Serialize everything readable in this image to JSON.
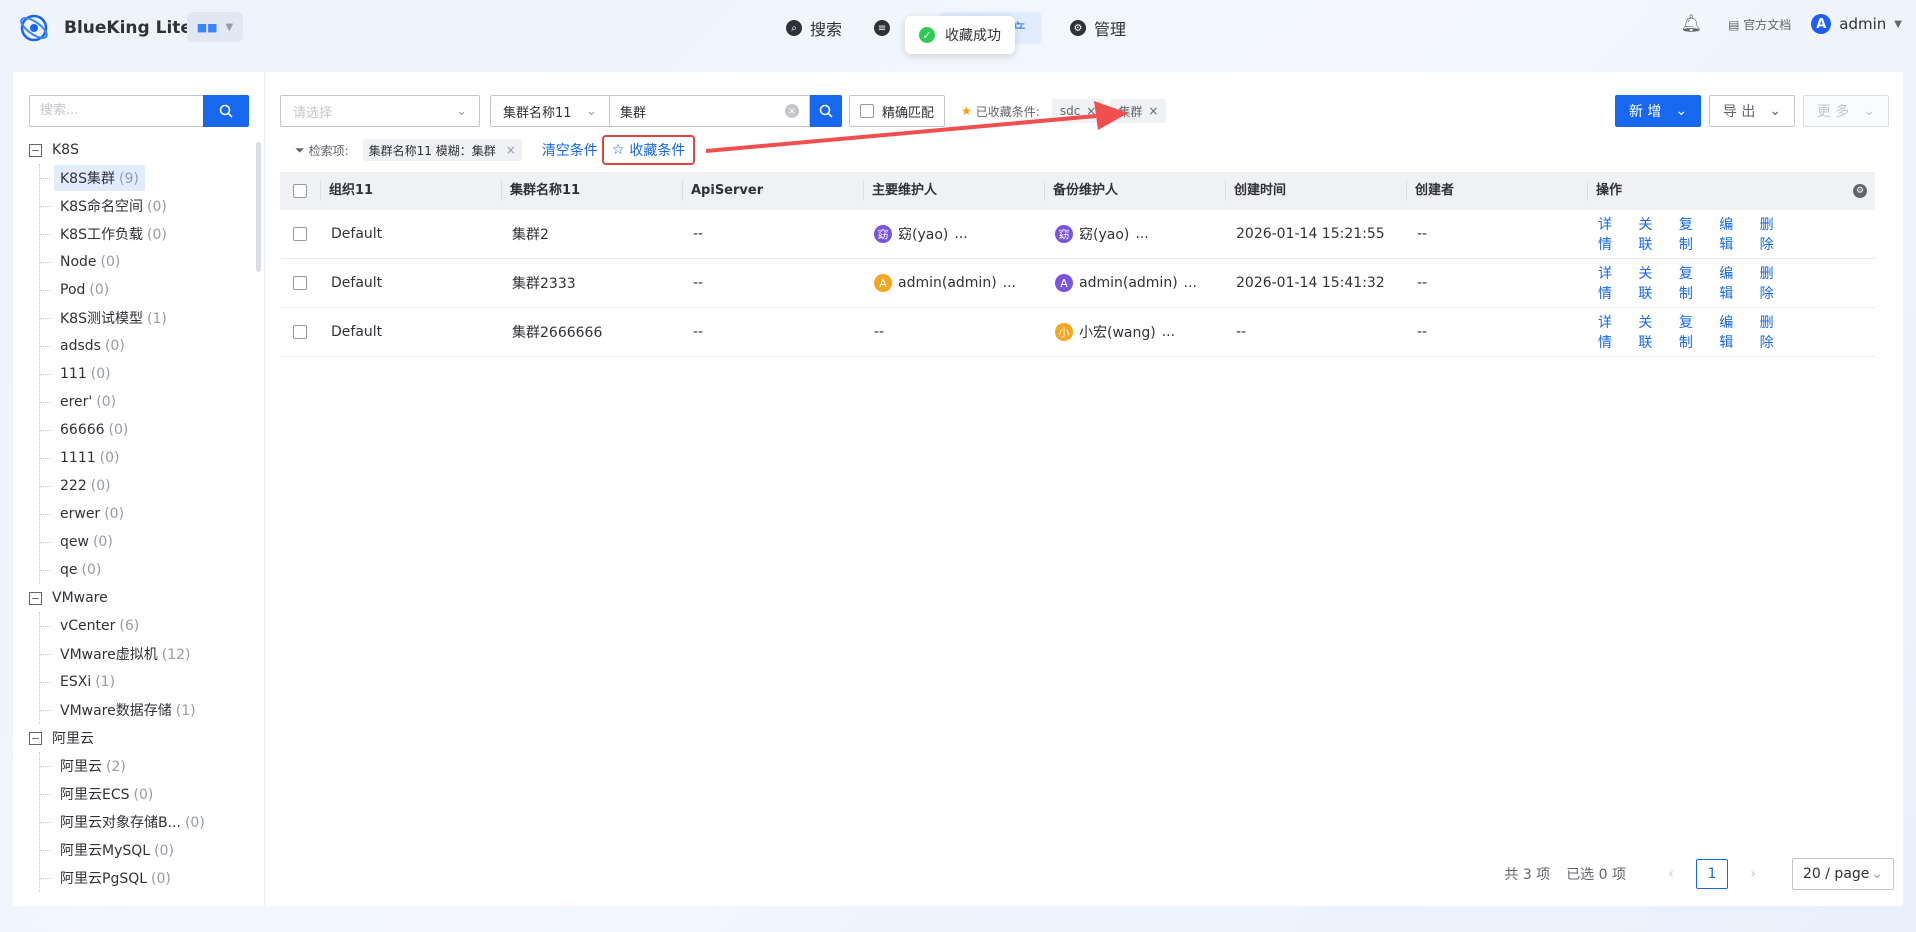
{
  "brand": {
    "name": "BlueKing Lite"
  },
  "nav": [
    {
      "label": "搜索",
      "icon": "search-icon"
    },
    {
      "label": "",
      "icon": "doc-icon"
    },
    {
      "label": "资产",
      "icon": "asset-icon"
    },
    {
      "label": "管理",
      "icon": "manage-icon"
    }
  ],
  "toast": {
    "text": "收藏成功"
  },
  "topright": {
    "docs": "官方文档",
    "user": "admin",
    "avatar_letter": "A"
  },
  "sidebar": {
    "search_placeholder": "搜索...",
    "groups": [
      {
        "label": "K8S",
        "toggle": "−",
        "children": [
          {
            "label": "K8S集群",
            "count": "(9)"
          },
          {
            "label": "K8S命名空间",
            "count": "(0)"
          },
          {
            "label": "K8S工作负载",
            "count": "(0)"
          },
          {
            "label": "Node",
            "count": "(0)"
          },
          {
            "label": "Pod",
            "count": "(0)"
          },
          {
            "label": "K8S测试模型",
            "count": "(1)"
          },
          {
            "label": "adsds",
            "count": "(0)"
          },
          {
            "label": "111",
            "count": "(0)"
          },
          {
            "label": "erer'",
            "count": "(0)"
          },
          {
            "label": "66666",
            "count": "(0)"
          },
          {
            "label": "1111",
            "count": "(0)"
          },
          {
            "label": "222",
            "count": "(0)"
          },
          {
            "label": "erwer",
            "count": "(0)"
          },
          {
            "label": "qew",
            "count": "(0)"
          },
          {
            "label": "qe",
            "count": "(0)"
          }
        ]
      },
      {
        "label": "VMware",
        "toggle": "−",
        "children": [
          {
            "label": "vCenter",
            "count": "(6)"
          },
          {
            "label": "VMware虚拟机",
            "count": "(12)"
          },
          {
            "label": "ESXi",
            "count": "(1)"
          },
          {
            "label": "VMware数据存储",
            "count": "(1)"
          }
        ]
      },
      {
        "label": "阿里云",
        "toggle": "−",
        "children": [
          {
            "label": "阿里云",
            "count": "(2)"
          },
          {
            "label": "阿里云ECS",
            "count": "(0)"
          },
          {
            "label": "阿里云对象存储B...",
            "count": "(0)"
          },
          {
            "label": "阿里云MySQL",
            "count": "(0)"
          },
          {
            "label": "阿里云PgSQL",
            "count": "(0)"
          }
        ]
      }
    ]
  },
  "filter": {
    "org_placeholder": "请选择",
    "field": "集群名称11",
    "value": "集群",
    "exact_label": "精确匹配",
    "saved_label": "已收藏条件:",
    "saved_tags": [
      "sdc",
      "集群"
    ]
  },
  "actions": {
    "add": "新 增",
    "export": "导 出",
    "more": "更 多"
  },
  "conditions": {
    "label": "检索项:",
    "tag": "集群名称11 模糊：集群",
    "clear": "清空条件",
    "favorite": "收藏条件"
  },
  "table": {
    "headers": [
      "组织11",
      "集群名称11",
      "ApiServer",
      "主要维护人",
      "备份维护人",
      "创建时间",
      "创建者",
      "操作"
    ],
    "rows": [
      {
        "org": "Default",
        "name": "集群2",
        "api": "--",
        "main": {
          "avatar": "窈",
          "name": "窈(yao)",
          "more": "...",
          "color": "#7a53e0"
        },
        "backup": {
          "avatar": "窈",
          "name": "窈(yao)",
          "more": "...",
          "color": "#7a53e0"
        },
        "created": "2026-01-14 15:21:55",
        "creator": "--"
      },
      {
        "org": "Default",
        "name": "集群2333",
        "api": "--",
        "main": {
          "avatar": "A",
          "name": "admin(admin)",
          "more": "...",
          "color": "#f5a623"
        },
        "backup": {
          "avatar": "A",
          "name": "admin(admin)",
          "more": "...",
          "color": "#7a53e0"
        },
        "created": "2026-01-14 15:41:32",
        "creator": "--"
      },
      {
        "org": "Default",
        "name": "集群2666666",
        "api": "--",
        "main": null,
        "main_empty": "--",
        "backup": {
          "avatar": "小",
          "name": "小宏(wang)",
          "more": "...",
          "color": "#f5a623"
        },
        "created": "--",
        "creator": "--"
      }
    ],
    "ops": [
      "详情",
      "关联",
      "复制",
      "编辑",
      "删除"
    ]
  },
  "pagination": {
    "total": "共 3 项",
    "selected": "已选 0 项",
    "page": "1",
    "size": "20 / page"
  },
  "colors": {
    "primary": "#1768ef",
    "highlight": "#e04545"
  }
}
